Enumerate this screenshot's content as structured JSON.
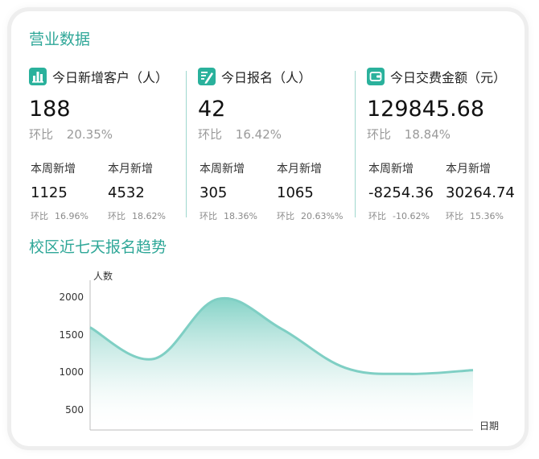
{
  "business_section": {
    "title": "营业数据",
    "columns": [
      {
        "icon": "bar-chart-icon",
        "title": "今日新增客户（人）",
        "value": "188",
        "ratio_label": "环比",
        "ratio_value": "20.35%",
        "week_label": "本周新增",
        "week_value": "1125",
        "week_ratio_label": "环比",
        "week_ratio": "16.96%",
        "month_label": "本月新增",
        "month_value": "4532",
        "month_ratio_label": "环比",
        "month_ratio": "18.62%"
      },
      {
        "icon": "edit-document-icon",
        "title": "今日报名（人）",
        "value": "42",
        "ratio_label": "环比",
        "ratio_value": "16.42%",
        "week_label": "本周新增",
        "week_value": "305",
        "week_ratio_label": "环比",
        "week_ratio": "18.36%",
        "month_label": "本月新增",
        "month_value": "1065",
        "month_ratio_label": "环比",
        "month_ratio": "20.63%%"
      },
      {
        "icon": "wallet-icon",
        "title": "今日交费金额（元）",
        "value": "129845.68",
        "ratio_label": "环比",
        "ratio_value": "18.84%",
        "week_label": "本周新增",
        "week_value": "-8254.36",
        "week_ratio_label": "环比",
        "week_ratio": "-10.62%",
        "month_label": "本月新增",
        "month_value": "30264.74",
        "month_ratio_label": "环比",
        "month_ratio": "15.36%"
      }
    ]
  },
  "chart_section": {
    "title": "校区近七天报名趋势"
  },
  "colors": {
    "accent": "#2fa798",
    "line": "#7fcfc4",
    "divider": "#9fd7ce"
  },
  "chart_data": {
    "type": "area",
    "title": "校区近七天报名趋势",
    "ylabel": "人数",
    "xlabel": "日期",
    "yticks": [
      500,
      1000,
      1500,
      2000
    ],
    "ylim": [
      250,
      2250
    ],
    "x": [
      0,
      1,
      2,
      3,
      4,
      5,
      6
    ],
    "values": [
      1620,
      1200,
      2000,
      1600,
      1080,
      1000,
      1050
    ],
    "grid": false,
    "smooth": true
  }
}
